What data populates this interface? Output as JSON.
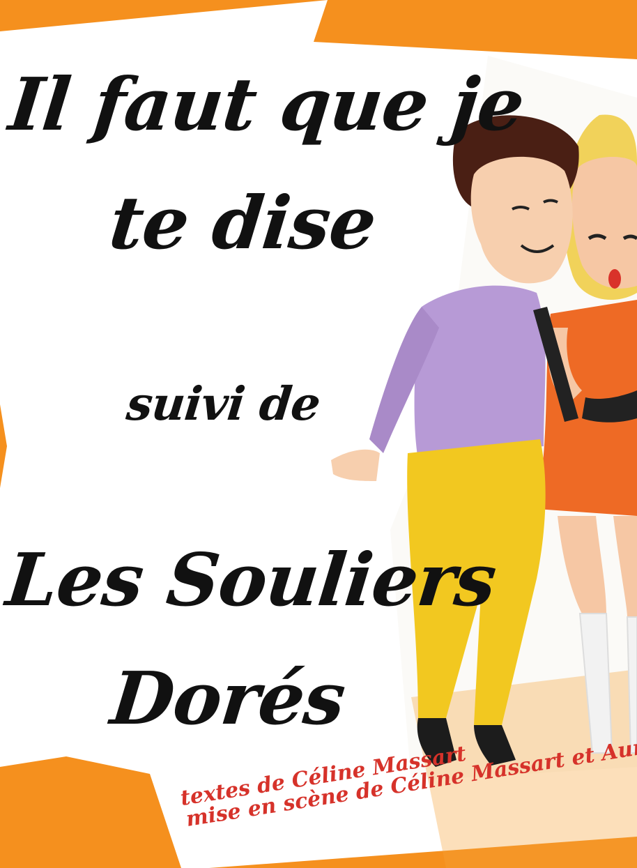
{
  "title_line1": "Il faut que je",
  "title_line2": "te dise",
  "connector": "suivi de",
  "subtitle_line1": "Les Souliers",
  "subtitle_line2": "Dorés",
  "credit_texts": "textes de Céline Massart",
  "credit_staging": "mise en scène de Céline Massart et Aurélien Vialette",
  "colors": {
    "background_orange": "#f5901e",
    "paper_white": "#ffffff",
    "title_black": "#111111",
    "credit_red": "#d6322a",
    "shirt_lavender": "#b79ad6",
    "trousers_yellow": "#f2c820",
    "dress_orange": "#ee6a25"
  },
  "illustration": {
    "subjects": [
      "man-figure",
      "woman-figure"
    ]
  }
}
